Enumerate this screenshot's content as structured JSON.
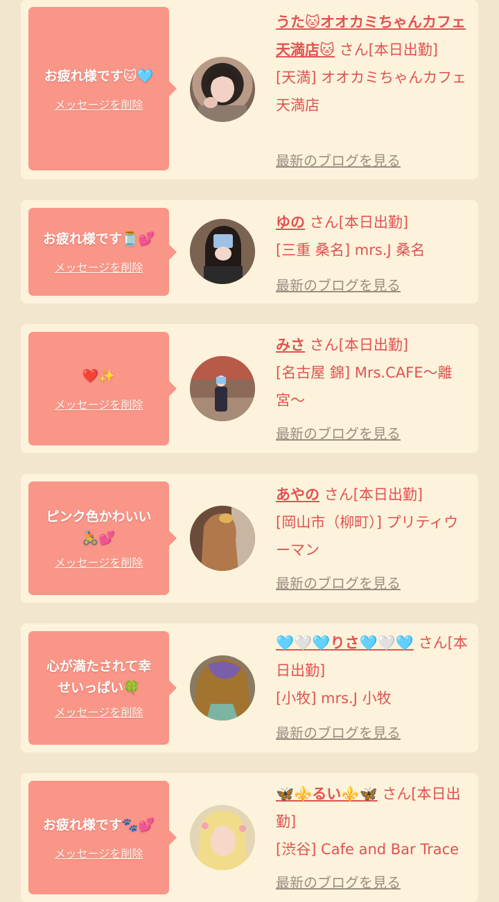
{
  "common": {
    "delete_label": "メッセージを削除",
    "blog_label": "最新のブログを見る"
  },
  "accent_colors": {
    "page_background": "#f3e6cf",
    "card_background": "#fdf3dc",
    "bubble_background": "#f99688",
    "text_red": "#e25151",
    "link_gray": "#9a8d80"
  },
  "entries": [
    {
      "message_line1": "お疲れ様です🐱🩵",
      "message_line2": "",
      "name": "うた🐱オオカミちゃんカフェ天満店🐱",
      "status": " さん[本日出勤]",
      "shop": "[天満] オオカミちゃんカフェ天満店"
    },
    {
      "message_line1": "お疲れ様です🫙💕",
      "message_line2": "",
      "name": "ゆの",
      "status": " さん[本日出勤]",
      "shop": "[三重 桑名] mrs.J 桑名"
    },
    {
      "message_line1": "❤️✨",
      "message_line2": "",
      "name": "みさ",
      "status": " さん[本日出勤]",
      "shop": "[名古屋 錦] Mrs.CAFE〜離宮〜"
    },
    {
      "message_line1": "ピンク色かわいい",
      "message_line2": "🚴💕",
      "name": "あやの",
      "status": " さん[本日出勤]",
      "shop": "[岡山市（柳町）] プリティウーマン"
    },
    {
      "message_line1": "心が満たされて幸",
      "message_line2": "せいっぱい🍀",
      "name": "🩵🤍🩵りさ🩵🤍🩵",
      "status": " さん[本日出勤]",
      "shop": "[小牧] mrs.J 小牧"
    },
    {
      "message_line1": "お疲れ様です🐾💕",
      "message_line2": "",
      "name": "🦋⚜️るい⚜️🦋",
      "status": " さん[本日出勤]",
      "shop": "[渋谷] Cafe and Bar Trace"
    }
  ]
}
